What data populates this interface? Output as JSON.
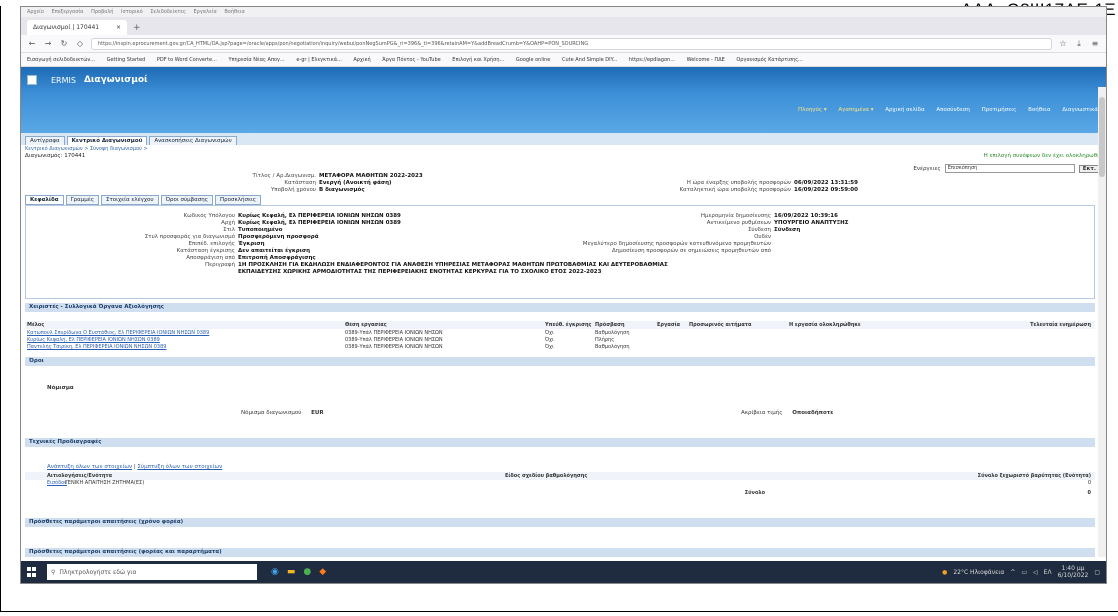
{
  "ada": "ΑΔΑ: Ω8Ψ17ΛΕ-1Ξ",
  "browser": {
    "menu": [
      "Αρχείο",
      "Επεξεργασία",
      "Προβολή",
      "Ιστορικό",
      "Σελιδοδείκτες",
      "Εργαλεία",
      "Βοήθεια"
    ],
    "tab_title": "Διαγωνισμοί | 170441",
    "url": "https://inspin.eprocurement.gov.gr/CA_HTML/OA.jsp?page=/oracle/apps/pon/negotiation/inquiry/webui/ponNegSumPG&_ri=396&_ti=396&retainAM=Y&addBreadCrumb=Y&OAHP=PON_SOURCING",
    "bookmarks": [
      "Εισαγωγή σελιδοδεικτών...",
      "Getting Started",
      "PDF to Word Converte...",
      "Υπηρεσία Νέας Απογ...",
      "e-gr | Ελεγκτικά...",
      "Αρχική",
      "Άργα Πόντος - YouTube",
      "Επιλογή και Χρήση...",
      "Google online",
      "Cute And Simple DIY...",
      "https://epdiagon...",
      "Welcome - ΠΔΕ",
      "Οργανισμός Κατάρτισης..."
    ]
  },
  "app": {
    "brand": "ERMIS",
    "title": "Διαγωνισμοί",
    "right_links": [
      "Πλοηγός ▾",
      "Αγαπημένα ▾",
      "Αρχική σελίδα",
      "Αποσύνδεση",
      "Προτιμήσεις",
      "Βοήθεια",
      "Διαγνωστικά"
    ],
    "main_tabs": [
      "Αντίγραφα",
      "Κεντρικό Διαγωνισμού",
      "Ανασκοπήσεις Διαγωνισμών"
    ],
    "breadcrumbs": "Κεντρικό Διαγωνισμών > Σύνοψη διαγωνισμού >",
    "doc_id": "Διαγωνισμός: 170441",
    "doc_msg": "Η επιλογή συνόψεων δεν έχει ολοκληρωθεί",
    "state_label": "Ενέργειες",
    "state_value": "Επισκόπηση",
    "state_button": "Εκτ."
  },
  "header_info": {
    "left": [
      {
        "k": "Τίτλος / Αρ.Διαγωνισμ.",
        "v": "ΜΕΤΑΦΟΡΑ ΜΑΘΗΤΩΝ 2022-2023"
      },
      {
        "k": "Κατάσταση",
        "v": "Ενεργή (Ανοικτή φάση)"
      },
      {
        "k": "Υποβολή χρόνου",
        "v": "Β διαγωνισμός"
      }
    ],
    "right": [
      {
        "k": "Η ώρα έναρξης υποβολής προσφορών",
        "v": "06/09/2022 13:31:59"
      },
      {
        "k": "Καταληκτική ώρα υποβολής προσφορών",
        "v": "16/09/2022 09:59:00"
      }
    ]
  },
  "sub_tabs": [
    "Κεφαλίδα",
    "Γραμμές",
    "Στοιχεία ελέγχου",
    "Όροι σύμβασης",
    "Προσκλήσεις"
  ],
  "details": {
    "left": [
      {
        "k": "Κωδικός Υπόλογου",
        "v": "Κυρίως Κεφαλή, Ελ ΠΕΡΙΦΕΡΕΙΑ ΙΟΝΙΩΝ ΝΗΣΩΝ 0389"
      },
      {
        "k": "Αρχή",
        "v": "Κυρίως Κεφαλή, Ελ ΠΕΡΙΦΕΡΕΙΑ ΙΟΝΙΩΝ ΝΗΣΩΝ 0389"
      },
      {
        "k": "Στιλ",
        "v": "Τυποποιημένο"
      },
      {
        "k": "Στυλ προσφοράς για διαγωνισμό",
        "v": "Προσφερόμενη προσφορά"
      },
      {
        "k": "Επιπέδ. επιλογής",
        "v": "Έγκριση"
      },
      {
        "k": "Κατάσταση έγκρισης",
        "v": "Δεν απαιτείται έγκριση"
      },
      {
        "k": "Αποσφράγιση από",
        "v": "Επιτροπή Αποσφράγισης"
      },
      {
        "k": "Περιγραφή",
        "v": "1Η ΠΡΟΣΚΛΗΣΗ ΓΙΑ ΕΚΔΗΛΩΣΗ ΕΝΔΙΑΦΕΡΟΝΤΟΣ ΓΙΑ ΑΝΑΘΕΣΗ ΥΠΗΡΕΣΙΑΣ ΜΕΤΑΦΟΡΑΣ ΜΑΘΗΤΩΝ ΠΡΩΤΟΒΑΘΜΙΑΣ ΚΑΙ ΔΕΥΤΕΡΟΒΑΘΜΙΑΣ"
      },
      {
        "k": "",
        "v": "ΕΚΠΑΙΔΕΥΣΗΣ ΧΩΡΙΚΗΣ ΑΡΜΟΔΙΟΤΗΤΑΣ ΤΗΣ ΠΕΡΙΦΕΡΕΙΑΚΗΣ ΕΝΟΤΗΤΑΣ ΚΕΡΚΥΡΑΣ ΓΙΑ ΤΟ ΣΧΟΛΙΚΟ ΕΤΟΣ 2022-2023"
      }
    ],
    "right": [
      {
        "k": "Ημερομηνία δημοσίευσης",
        "v": "16/09/2022 10:39:16"
      },
      {
        "k": "Αντικείμενο ρυθμίσεων",
        "v": "ΥΠΟΥΡΓΕΙΟ ΑΝΑΠΤΥΞΗΣ"
      },
      {
        "k": "Σύνδεση",
        "v": "Σύνδεση"
      },
      {
        "k": "Ουδέν",
        "v": ""
      },
      {
        "k": "Μεγαλύτερο δημοσίευσης προσφορών κατευθυνόμενο προμηθευτών",
        "v": ""
      },
      {
        "k": "Δημοσίευση προσφορών σε σημειώσεις προμηθευτών από",
        "v": ""
      }
    ]
  },
  "sections": {
    "evaluators": "Χειριστές - Συλλογικά Όργανα Αξιολόγησης",
    "terms": "Όροι",
    "requirements": "Τεχνικές Προδιαγραφές",
    "extra1": "Πρόσθετες παράμετροι απαιτήσεις (χρόνο φορέα)",
    "extra2": "Πρόσθετες παράμετροι απαιτήσεις (φορέας και παραρτήματα)"
  },
  "eval_table": {
    "headers": [
      "Μέλος",
      "Θέση εργασίας",
      "Υπεύθ. έγκρισης",
      "Πρόσβαση",
      "Εργασία",
      "Προσωρινός αιτήματα",
      "Η εργασία ολοκληρώθηκε",
      "Τελευταία ενημέρωση"
    ],
    "rows": [
      [
        "Κατωπούλ Σπυρίδωνα Ο Ευστάθιος, Ελ ΠΕΡΙΦΕΡΕΙΑ ΙΟΝΙΩΝ ΝΗΣΩΝ 0389",
        "0389-Υπάλ ΠΕΡΙΦΕΡΕΙΑ ΙΟΝΙΩΝ ΝΗΣΩΝ",
        "Όχι",
        "Βαθμολόγηση",
        "",
        "",
        "",
        ""
      ],
      [
        "Κυρίως Κεφαλή, Ελ ΠΕΡΙΦΕΡΕΙΑ ΙΟΝΙΩΝ ΝΗΣΩΝ 0389",
        "0389-Υπάλ ΠΕΡΙΦΕΡΕΙΑ ΙΟΝΙΩΝ ΝΗΣΩΝ",
        "Όχι",
        "Πλήρης",
        "",
        "",
        "",
        ""
      ],
      [
        "Παντελής Τσιρίκη, Ελ ΠΕΡΙΦΕΡΕΙΑ ΙΟΝΙΩΝ ΝΗΣΩΝ 0389",
        "0389-Υπάλ ΠΕΡΙΦΕΡΕΙΑ ΙΟΝΙΩΝ ΝΗΣΩΝ",
        "Όχι",
        "Βαθμολόγηση",
        "",
        "",
        "",
        ""
      ]
    ]
  },
  "terms": {
    "label": "Νόμισμα",
    "currency_label": "Νόμισμα διαγωνισμού",
    "currency_value": "EUR",
    "rate_label": "Ακρίβεια τιμής",
    "rate_value": "Οποιαδήποτε"
  },
  "req": {
    "links": [
      "Ανάπτυξη όλων των στοιχείων",
      "Σύμπτυξη όλων των στοιχείων"
    ],
    "headers": [
      "Αιτιολογήσεις/Ενότητα",
      "Είδος σχεδίου βαθμολόγησης",
      "Σύνολο ξεχωριστό βαρύτητας (Ενότητα)"
    ],
    "row": [
      "Εισόδου",
      "ΓΕΝΙΚΗ ΑΠΑΙΤΗΣΗ ΖΗΤΗΜΑ(ΕΣ)",
      "",
      "0"
    ],
    "total_label": "Σύνολο",
    "total_value": "0"
  },
  "taskbar": {
    "search_placeholder": "Πληκτρολογήστε εδώ για",
    "weather": "22°C Ηλιοφάνεια",
    "lang": "ΕΛ",
    "time": "1:40 μμ",
    "date": "6/10/2022"
  }
}
